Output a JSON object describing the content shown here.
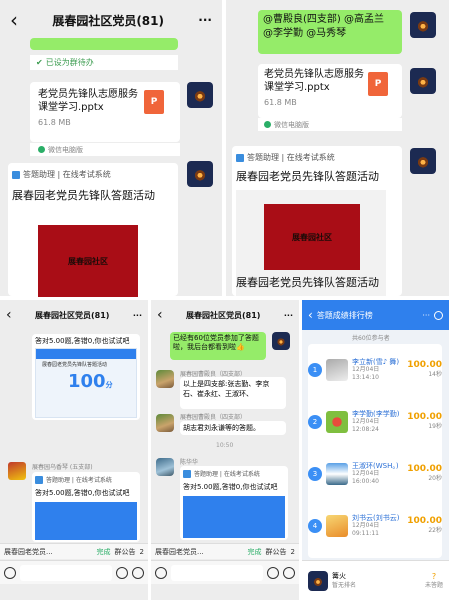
{
  "top_left": {
    "header_title": "展春园社区党员(81)",
    "back_icon": "‹",
    "more_icon": "···",
    "set_todo_label": "已设为群待办",
    "file_name": "老党员先锋队志愿服务课堂学习.pptx",
    "file_size": "61.8 MB",
    "file_source": "微信电脑版",
    "mini_system": "答题助理 | 在线考试系统",
    "mini_title": "展春园老党员先锋队答题活动",
    "book_text": "展春园社区"
  },
  "top_right": {
    "mention_text": "@曹殿良(四支部) @高孟兰 @李学勤 @马秀琴",
    "file_name": "老党员先锋队志愿服务课堂学习.pptx",
    "file_size": "61.8 MB",
    "file_source": "微信电脑版",
    "mini_system": "答题助理 | 在线考试系统",
    "mini_title": "展春园老党员先锋队答题活动",
    "book_text": "展春园社区"
  },
  "bottom_left": {
    "header_title": "展春园社区党员(81)",
    "answer_text": "答对5.00题,答错0,你也试试吧",
    "score_big": "100",
    "score_unit": "分",
    "quote_text": "展春园老党员先锋队答题活动",
    "sender_name": "展春园乌香琴 (五支部)",
    "mini_system": "答题助理 | 在线考试系统",
    "answer_text2": "答对5.00题,答错0,你也试试吧",
    "bottom_group": "展春园老党员...",
    "done_label": "完成",
    "notice_label": "群公告",
    "count_label": "2"
  },
  "bottom_mid": {
    "header_title": "展春园社区党员(81)",
    "green_text": "已经有60位党员参加了答题啦，我后台都看到啦👍",
    "name1": "展春园曹殿良（四支部）",
    "msg1": "以上是四支部:张志勤、李京石、崔永红、王淑环、",
    "name2": "展春园曹殿良（四支部）",
    "msg2": "胡志君刘永谦等的答题。",
    "time": "10:50",
    "name3": "陈华华",
    "mini_system": "答题助理 | 在线考试系统",
    "answer_text": "答对5.00题,答错0,你也试试吧",
    "bottom_group": "展春园老党员...",
    "done_label": "完成",
    "notice_label": "群公告",
    "count_label": "2"
  },
  "bottom_right": {
    "header_title": "答题成绩排行榜",
    "participants": "共60位参与者",
    "rows": [
      {
        "rank": "1",
        "name": "李立新(雪♪ 舞)",
        "date": "12月04日13:14:10",
        "score": "100.00",
        "secs": "14秒"
      },
      {
        "rank": "2",
        "name": "李学勤(李学勤)",
        "date": "12月04日12:08:24",
        "score": "100.00",
        "secs": "19秒"
      },
      {
        "rank": "3",
        "name": "王淑环(WSH。)",
        "date": "12月04日16:00:40",
        "score": "100.00",
        "secs": "20秒"
      },
      {
        "rank": "4",
        "name": "刘书云(刘书云)",
        "date": "12月04日09:11:11",
        "score": "100.00",
        "secs": "22秒"
      }
    ],
    "footer_name": "篝火",
    "footer_sub": "暂无排名",
    "footer_right": "未答题"
  }
}
